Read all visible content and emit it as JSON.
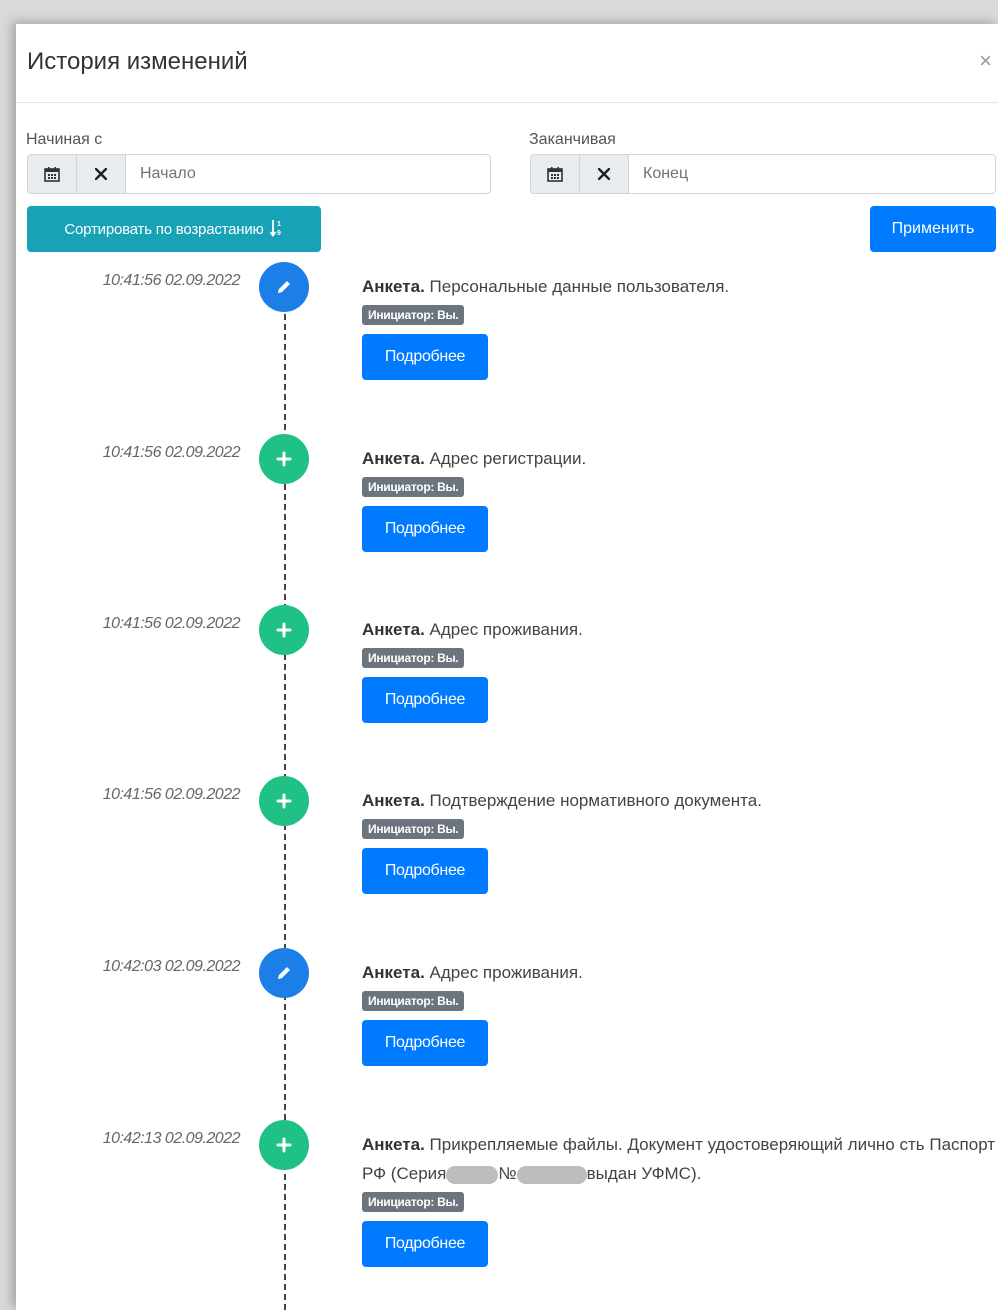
{
  "modal": {
    "title": "История изменений",
    "close_symbol": "×"
  },
  "filters": {
    "from": {
      "label": "Начиная с",
      "placeholder": "Начало",
      "value": ""
    },
    "to": {
      "label": "Заканчивая",
      "placeholder": "Конец",
      "value": ""
    },
    "calendar_icon": "calendar-icon",
    "clear_icon": "clear-icon"
  },
  "actions": {
    "sort_label": "Сортировать по возрастанию",
    "sort_icon": "sort-numeric-asc-icon",
    "apply_label": "Применить"
  },
  "colors": {
    "edit_marker": "#1c7fe8",
    "add_marker": "#20c184",
    "sort_button": "#17a2b8",
    "primary_button": "#007bff",
    "badge": "#6c757d"
  },
  "entries": [
    {
      "time": "10:41:56 02.09.2022",
      "type": "edit",
      "category": "Анкета.",
      "text": "Персональные данные пользователя.",
      "initiator": "Инициатор: Вы.",
      "details_label": "Подробнее"
    },
    {
      "time": "10:41:56 02.09.2022",
      "type": "add",
      "category": "Анкета.",
      "text": "Адрес регистрации.",
      "initiator": "Инициатор: Вы.",
      "details_label": "Подробнее"
    },
    {
      "time": "10:41:56 02.09.2022",
      "type": "add",
      "category": "Анкета.",
      "text": "Адрес проживания.",
      "initiator": "Инициатор: Вы.",
      "details_label": "Подробнее"
    },
    {
      "time": "10:41:56 02.09.2022",
      "type": "add",
      "category": "Анкета.",
      "text": "Подтверждение нормативного документа.",
      "initiator": "Инициатор: Вы.",
      "details_label": "Подробнее"
    },
    {
      "time": "10:42:03 02.09.2022",
      "type": "edit",
      "category": "Анкета.",
      "text": "Адрес проживания.",
      "initiator": "Инициатор: Вы.",
      "details_label": "Подробнее"
    },
    {
      "time": "10:42:13 02.09.2022",
      "type": "add",
      "category": "Анкета.",
      "text_parts": [
        "Прикрепляемые файлы. Документ удостоверяющий лично сть Паспорт РФ (Серия",
        "№",
        "выдан УФМС)."
      ],
      "initiator": "Инициатор: Вы.",
      "details_label": "Подробнее"
    }
  ]
}
